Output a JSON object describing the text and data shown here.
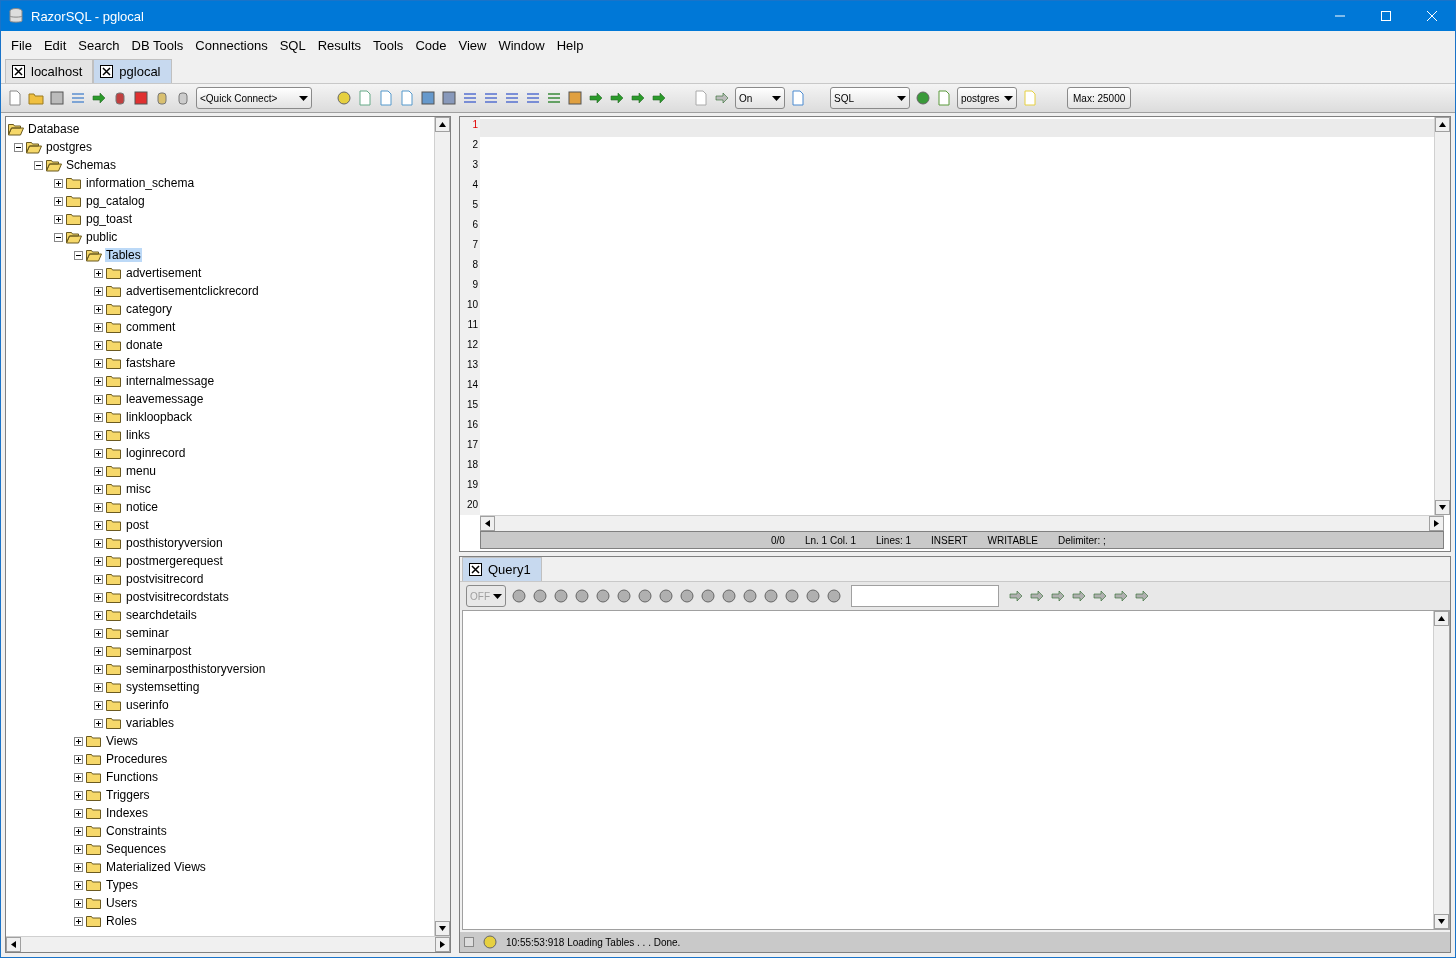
{
  "window": {
    "title": "RazorSQL - pglocal"
  },
  "menu": [
    "File",
    "Edit",
    "Search",
    "DB Tools",
    "Connections",
    "SQL",
    "Results",
    "Tools",
    "Code",
    "View",
    "Window",
    "Help"
  ],
  "connection_tabs": [
    {
      "label": "localhost",
      "selected": false
    },
    {
      "label": "pglocal",
      "selected": true
    }
  ],
  "toolbar": {
    "quick_connect": "<Quick Connect>",
    "auto_commit": "On",
    "language": "SQL",
    "database": "postgres",
    "max_rows": "Max: 25000"
  },
  "tree": [
    {
      "label": "Database",
      "expanded": true,
      "selected": false,
      "children": [
        {
          "label": "postgres",
          "expanded": true,
          "selected": false,
          "children": [
            {
              "label": "Schemas",
              "expanded": true,
              "selected": false,
              "children": [
                {
                  "label": "information_schema",
                  "expanded": false,
                  "selected": false
                },
                {
                  "label": "pg_catalog",
                  "expanded": false,
                  "selected": false
                },
                {
                  "label": "pg_toast",
                  "expanded": false,
                  "selected": false
                },
                {
                  "label": "public",
                  "expanded": true,
                  "selected": false,
                  "children": [
                    {
                      "label": "Tables",
                      "expanded": true,
                      "selected": true,
                      "children": [
                        {
                          "label": "advertisement",
                          "expanded": false,
                          "selected": false
                        },
                        {
                          "label": "advertisementclickrecord",
                          "expanded": false,
                          "selected": false
                        },
                        {
                          "label": "category",
                          "expanded": false,
                          "selected": false
                        },
                        {
                          "label": "comment",
                          "expanded": false,
                          "selected": false
                        },
                        {
                          "label": "donate",
                          "expanded": false,
                          "selected": false
                        },
                        {
                          "label": "fastshare",
                          "expanded": false,
                          "selected": false
                        },
                        {
                          "label": "internalmessage",
                          "expanded": false,
                          "selected": false
                        },
                        {
                          "label": "leavemessage",
                          "expanded": false,
                          "selected": false
                        },
                        {
                          "label": "linkloopback",
                          "expanded": false,
                          "selected": false
                        },
                        {
                          "label": "links",
                          "expanded": false,
                          "selected": false
                        },
                        {
                          "label": "loginrecord",
                          "expanded": false,
                          "selected": false
                        },
                        {
                          "label": "menu",
                          "expanded": false,
                          "selected": false
                        },
                        {
                          "label": "misc",
                          "expanded": false,
                          "selected": false
                        },
                        {
                          "label": "notice",
                          "expanded": false,
                          "selected": false
                        },
                        {
                          "label": "post",
                          "expanded": false,
                          "selected": false
                        },
                        {
                          "label": "posthistoryversion",
                          "expanded": false,
                          "selected": false
                        },
                        {
                          "label": "postmergerequest",
                          "expanded": false,
                          "selected": false
                        },
                        {
                          "label": "postvisitrecord",
                          "expanded": false,
                          "selected": false
                        },
                        {
                          "label": "postvisitrecordstats",
                          "expanded": false,
                          "selected": false
                        },
                        {
                          "label": "searchdetails",
                          "expanded": false,
                          "selected": false
                        },
                        {
                          "label": "seminar",
                          "expanded": false,
                          "selected": false
                        },
                        {
                          "label": "seminarpost",
                          "expanded": false,
                          "selected": false
                        },
                        {
                          "label": "seminarposthistoryversion",
                          "expanded": false,
                          "selected": false
                        },
                        {
                          "label": "systemsetting",
                          "expanded": false,
                          "selected": false
                        },
                        {
                          "label": "userinfo",
                          "expanded": false,
                          "selected": false
                        },
                        {
                          "label": "variables",
                          "expanded": false,
                          "selected": false
                        }
                      ]
                    },
                    {
                      "label": "Views",
                      "expanded": false,
                      "selected": false
                    },
                    {
                      "label": "Procedures",
                      "expanded": false,
                      "selected": false
                    },
                    {
                      "label": "Functions",
                      "expanded": false,
                      "selected": false
                    },
                    {
                      "label": "Triggers",
                      "expanded": false,
                      "selected": false
                    },
                    {
                      "label": "Indexes",
                      "expanded": false,
                      "selected": false
                    },
                    {
                      "label": "Constraints",
                      "expanded": false,
                      "selected": false
                    },
                    {
                      "label": "Sequences",
                      "expanded": false,
                      "selected": false
                    },
                    {
                      "label": "Materialized Views",
                      "expanded": false,
                      "selected": false
                    },
                    {
                      "label": "Types",
                      "expanded": false,
                      "selected": false
                    },
                    {
                      "label": "Users",
                      "expanded": false,
                      "selected": false
                    },
                    {
                      "label": "Roles",
                      "expanded": false,
                      "selected": false
                    }
                  ]
                }
              ]
            }
          ]
        }
      ]
    }
  ],
  "editor": {
    "lines": [
      {
        "number": "1",
        "current": true
      },
      {
        "number": "2",
        "current": false
      },
      {
        "number": "3",
        "current": false
      },
      {
        "number": "4",
        "current": false
      },
      {
        "number": "5",
        "current": false
      },
      {
        "number": "6",
        "current": false
      },
      {
        "number": "7",
        "current": false
      },
      {
        "number": "8",
        "current": false
      },
      {
        "number": "9",
        "current": false
      },
      {
        "number": "10",
        "current": false
      },
      {
        "number": "11",
        "current": false
      },
      {
        "number": "12",
        "current": false
      },
      {
        "number": "13",
        "current": false
      },
      {
        "number": "14",
        "current": false
      },
      {
        "number": "15",
        "current": false
      },
      {
        "number": "16",
        "current": false
      },
      {
        "number": "17",
        "current": false
      },
      {
        "number": "18",
        "current": false
      },
      {
        "number": "19",
        "current": false
      },
      {
        "number": "20",
        "current": false
      }
    ],
    "status": [
      "0/0",
      "Ln. 1 Col. 1",
      "Lines: 1",
      "INSERT",
      "WRITABLE",
      "Delimiter: ;"
    ]
  },
  "result_tabs": [
    {
      "label": "Query1",
      "selected": true
    }
  ],
  "results_toolbar": {
    "mode": "OFF",
    "mode_disabled": true
  },
  "status_bar": {
    "message": "10:55:53:918 Loading Tables . . . Done."
  }
}
